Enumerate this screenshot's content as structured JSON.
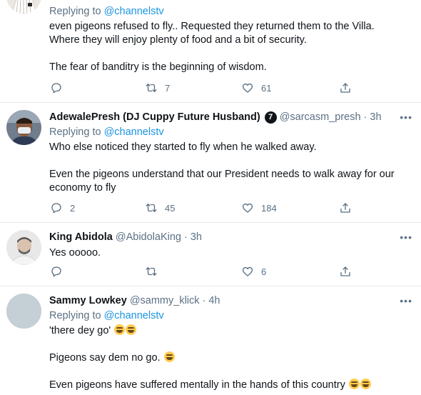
{
  "tweets": [
    {
      "replying_prefix": "Replying to",
      "replying_to": "@channelstv",
      "lines": [
        "even pigeons refused to fly.. Requested they returned them to the Villa.",
        "Where they will enjoy plenty of food and a bit of security.",
        "",
        "The fear of banditry is the beginning of wisdom."
      ],
      "retweets": "7",
      "likes": "61"
    },
    {
      "name": "AdewalePresh (DJ Cuppy Future Husband)",
      "badge": "7",
      "handle": "@sarcasm_presh",
      "time": "3h",
      "replying_prefix": "Replying to",
      "replying_to": "@channelstv",
      "lines": [
        "Who else noticed they started to fly when he walked away.",
        "",
        "Even the pigeons understand that our President needs to walk away for our",
        "economy to fly"
      ],
      "replies": "2",
      "retweets": "45",
      "likes": "184"
    },
    {
      "name": "King Abidola",
      "handle": "@AbidolaKing",
      "time": "3h",
      "lines": [
        "Yes ooooo."
      ],
      "likes": "6"
    },
    {
      "name": "Sammy Lowkey",
      "handle": "@sammy_klick",
      "time": "4h",
      "replying_prefix": "Replying to",
      "replying_to": "@channelstv",
      "lines": [
        "'there dey go'",
        "",
        "Pigeons say dem no go.",
        "",
        "Even pigeons have suffered mentally in the hands of this country"
      ]
    }
  ],
  "separator": "·",
  "more_glyph": "•••",
  "icons": [
    "reply-icon",
    "retweet-icon",
    "like-icon",
    "share-icon",
    "laughing-emoji-icon",
    "more-icon"
  ]
}
